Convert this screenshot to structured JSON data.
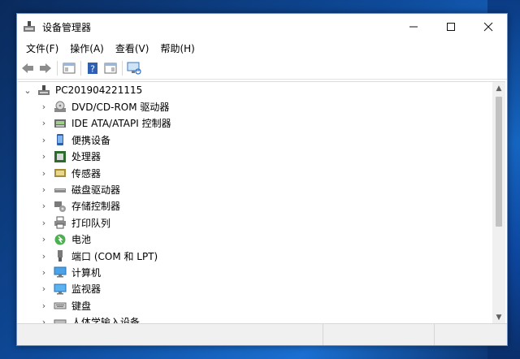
{
  "window": {
    "title": "设备管理器",
    "minimize_icon": "minimize-icon",
    "maximize_icon": "maximize-icon",
    "close_icon": "close-icon"
  },
  "menu": [
    "文件(F)",
    "操作(A)",
    "查看(V)",
    "帮助(H)"
  ],
  "toolbar": [
    "back-arrow-icon",
    "forward-arrow-icon",
    "properties-icon",
    "help-icon",
    "properties-panel-icon",
    "scan-hardware-icon"
  ],
  "tree": {
    "root": "PC201904221115",
    "items": [
      {
        "label": "DVD/CD-ROM 驱动器",
        "icon": "dvd-drive-icon"
      },
      {
        "label": "IDE ATA/ATAPI 控制器",
        "icon": "ide-controller-icon"
      },
      {
        "label": "便携设备",
        "icon": "portable-device-icon"
      },
      {
        "label": "处理器",
        "icon": "processor-icon"
      },
      {
        "label": "传感器",
        "icon": "sensor-icon"
      },
      {
        "label": "磁盘驱动器",
        "icon": "disk-drive-icon"
      },
      {
        "label": "存储控制器",
        "icon": "storage-controller-icon"
      },
      {
        "label": "打印队列",
        "icon": "printer-icon"
      },
      {
        "label": "电池",
        "icon": "battery-icon"
      },
      {
        "label": "端口 (COM 和 LPT)",
        "icon": "port-icon"
      },
      {
        "label": "计算机",
        "icon": "computer-icon"
      },
      {
        "label": "监视器",
        "icon": "monitor-icon"
      },
      {
        "label": "键盘",
        "icon": "keyboard-icon"
      },
      {
        "label": "人体学输入设备",
        "icon": "hid-icon"
      }
    ]
  },
  "colors": {
    "accent": "#0e4a9a",
    "window_bg": "#ffffff",
    "statusbar": "#f0f0f0"
  }
}
